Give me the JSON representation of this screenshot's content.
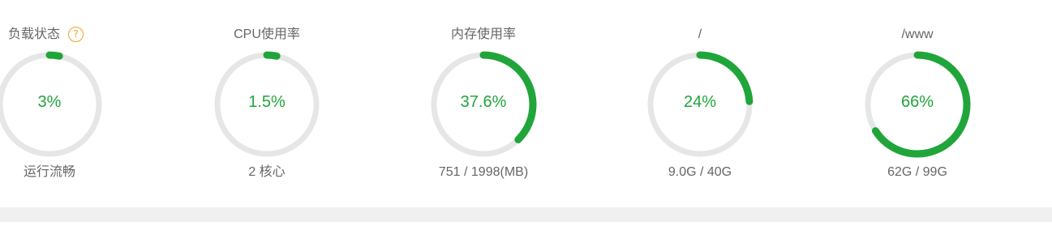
{
  "theme": {
    "accent": "#20a53a",
    "track": "#e6e6e6",
    "help_color": "#f0a020"
  },
  "gauges": [
    {
      "title": "负载状态",
      "has_help": true,
      "help_glyph": "?",
      "help_icon": "question-circle-icon",
      "value_text": "3%",
      "percent": 3,
      "sub": "运行流畅"
    },
    {
      "title": "CPU使用率",
      "has_help": false,
      "value_text": "1.5%",
      "percent": 1.5,
      "sub": "2 核心"
    },
    {
      "title": "内存使用率",
      "has_help": false,
      "value_text": "37.6%",
      "percent": 37.6,
      "sub": "751 / 1998(MB)"
    },
    {
      "title": "/",
      "has_help": false,
      "value_text": "24%",
      "percent": 24,
      "sub": "9.0G / 40G"
    },
    {
      "title": "/www",
      "has_help": false,
      "value_text": "66%",
      "percent": 66,
      "sub": "62G / 99G"
    }
  ]
}
